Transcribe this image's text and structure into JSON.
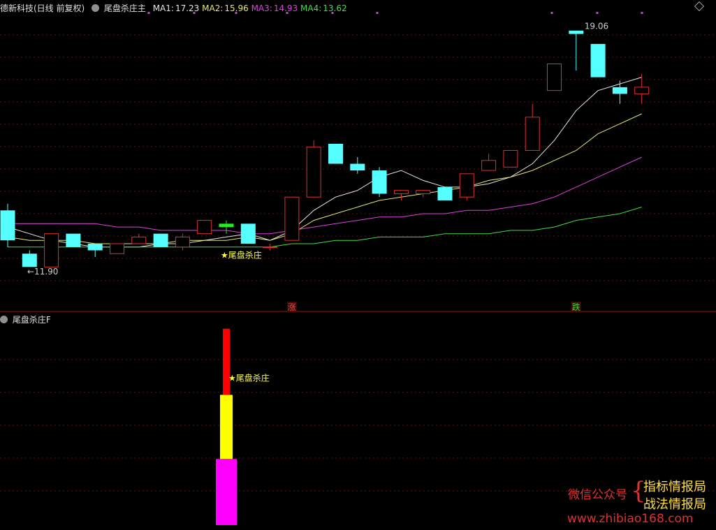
{
  "header": {
    "stock": "德新科技(日线 前复权)",
    "indicator_name": "尾盘杀庄主",
    "ma": [
      {
        "label": "MA1:",
        "value": "17.23",
        "color": "#e8e8e8"
      },
      {
        "label": "MA2:",
        "value": "15.96",
        "color": "#e8e870"
      },
      {
        "label": "MA3:",
        "value": "14.93",
        "color": "#e040e0"
      },
      {
        "label": "MA4:",
        "value": "13.62",
        "color": "#40e040"
      }
    ]
  },
  "sub_header": {
    "indicator_name": "尾盘杀庄F"
  },
  "watermark": {
    "wechat": "微信公众号",
    "name1": "指标情报局",
    "name2": "战法情报局",
    "url": "www.zhibiao168.com"
  },
  "icons": [
    "chevron-circle-icon",
    "diamond-icon"
  ],
  "chart_data": [
    {
      "type": "candlestick",
      "title": "德新科技(日线 前复权)",
      "ylim": [
        11.0,
        19.6
      ],
      "grid": true,
      "candles": [
        {
          "o": 13.7,
          "h": 13.9,
          "l": 12.6,
          "c": 12.8
        },
        {
          "o": 12.4,
          "h": 12.5,
          "l": 12.0,
          "c": 12.0
        },
        {
          "o": 12.0,
          "h": 13.0,
          "l": 12.0,
          "c": 13.0
        },
        {
          "o": 13.0,
          "h": 13.0,
          "l": 12.6,
          "c": 12.6
        },
        {
          "o": 12.7,
          "h": 12.7,
          "l": 12.3,
          "c": 12.5
        },
        {
          "o": 12.4,
          "h": 12.7,
          "l": 12.4,
          "c": 12.7
        },
        {
          "o": 12.7,
          "h": 13.0,
          "l": 12.7,
          "c": 12.9
        },
        {
          "o": 13.0,
          "h": 13.0,
          "l": 12.6,
          "c": 12.6
        },
        {
          "o": 12.6,
          "h": 13.0,
          "l": 12.5,
          "c": 12.9
        },
        {
          "o": 13.0,
          "h": 13.4,
          "l": 13.0,
          "c": 13.4
        },
        {
          "o": 13.2,
          "h": 13.4,
          "l": 13.0,
          "c": 13.3
        },
        {
          "o": 13.3,
          "h": 13.3,
          "l": 12.7,
          "c": 12.7
        },
        {
          "o": 12.6,
          "h": 12.7,
          "l": 12.5,
          "c": 12.6
        },
        {
          "o": 12.8,
          "h": 14.1,
          "l": 12.8,
          "c": 14.1
        },
        {
          "o": 14.1,
          "h": 15.8,
          "l": 14.1,
          "c": 15.6
        },
        {
          "o": 15.7,
          "h": 15.7,
          "l": 15.1,
          "c": 15.1
        },
        {
          "o": 15.1,
          "h": 15.3,
          "l": 14.8,
          "c": 14.9
        },
        {
          "o": 14.9,
          "h": 15.0,
          "l": 14.1,
          "c": 14.2
        },
        {
          "o": 14.2,
          "h": 14.3,
          "l": 14.0,
          "c": 14.3
        },
        {
          "o": 14.2,
          "h": 14.3,
          "l": 14.1,
          "c": 14.3
        },
        {
          "o": 14.4,
          "h": 14.4,
          "l": 14.0,
          "c": 14.0
        },
        {
          "o": 14.1,
          "h": 14.8,
          "l": 14.0,
          "c": 14.8
        },
        {
          "o": 14.9,
          "h": 15.4,
          "l": 14.9,
          "c": 15.2
        },
        {
          "o": 15.0,
          "h": 15.5,
          "l": 15.0,
          "c": 15.5
        },
        {
          "o": 15.5,
          "h": 16.9,
          "l": 15.5,
          "c": 16.5
        },
        {
          "o": 17.3,
          "h": 18.1,
          "l": 17.3,
          "c": 18.1
        },
        {
          "o": 19.1,
          "h": 19.1,
          "l": 17.9,
          "c": 19.0
        },
        {
          "o": 18.7,
          "h": 18.7,
          "l": 17.7,
          "c": 17.7
        },
        {
          "o": 17.4,
          "h": 17.6,
          "l": 16.9,
          "c": 17.2
        },
        {
          "o": 17.2,
          "h": 17.8,
          "l": 16.9,
          "c": 17.4
        }
      ],
      "series": [
        {
          "name": "MA1",
          "color": "#e8e8e8",
          "values": [
            13.2,
            13.0,
            12.8,
            12.7,
            12.6,
            12.6,
            12.6,
            12.7,
            12.7,
            12.8,
            12.9,
            13.0,
            12.8,
            13.1,
            13.7,
            14.1,
            14.3,
            14.7,
            14.9,
            14.6,
            14.4,
            14.4,
            14.5,
            14.7,
            15.1,
            15.8,
            16.7,
            17.3,
            17.5,
            17.7
          ]
        },
        {
          "name": "MA2",
          "color": "#e8e870",
          "values": [
            12.9,
            12.8,
            12.8,
            12.8,
            12.7,
            12.7,
            12.7,
            12.7,
            12.8,
            12.8,
            12.8,
            12.9,
            12.8,
            13.0,
            13.4,
            13.6,
            13.8,
            14.0,
            14.1,
            14.2,
            14.3,
            14.4,
            14.6,
            14.7,
            14.9,
            15.2,
            15.5,
            16.0,
            16.3,
            16.6
          ]
        },
        {
          "name": "MA3",
          "color": "#e040e0",
          "values": [
            13.3,
            13.3,
            13.3,
            13.3,
            13.3,
            13.2,
            13.2,
            13.1,
            13.1,
            13.1,
            13.1,
            13.0,
            13.0,
            13.1,
            13.2,
            13.3,
            13.4,
            13.5,
            13.5,
            13.6,
            13.6,
            13.7,
            13.7,
            13.8,
            13.9,
            14.1,
            14.4,
            14.7,
            15.0,
            15.3
          ]
        },
        {
          "name": "MA4",
          "color": "#40e040",
          "values": [
            12.6,
            12.6,
            12.6,
            12.6,
            12.6,
            12.6,
            12.6,
            12.6,
            12.6,
            12.6,
            12.6,
            12.6,
            12.6,
            12.7,
            12.7,
            12.8,
            12.8,
            12.9,
            12.9,
            12.9,
            13.0,
            13.0,
            13.0,
            13.1,
            13.1,
            13.2,
            13.4,
            13.5,
            13.6,
            13.8
          ]
        }
      ],
      "special_candle_index": 10,
      "annotations": [
        {
          "index": 10,
          "text": "★尾盘杀庄",
          "color": "#ffff33",
          "y": 12.4
        },
        {
          "index": 0,
          "text": "←11.90",
          "y": 11.9,
          "color": "#d0d0d0"
        },
        {
          "index": 26,
          "text": "19.06",
          "y": 19.06,
          "color": "#d0d0d0"
        }
      ],
      "markers": [
        {
          "index": 13,
          "text": "涨",
          "color": "#ff4040"
        },
        {
          "index": 26,
          "text": "跌",
          "color": "#30e030"
        }
      ]
    },
    {
      "type": "bar",
      "title": "尾盘杀庄F",
      "ylim": [
        0,
        100
      ],
      "index": 10,
      "segments": [
        {
          "from": 0,
          "to": 33,
          "color": "#ff00ff"
        },
        {
          "from": 33,
          "to": 65,
          "color": "#ffff00"
        },
        {
          "from": 65,
          "to": 98,
          "color": "#ff0000"
        }
      ],
      "annotations": [
        {
          "text": "★尾盘杀庄",
          "color": "#ffff33",
          "y": 74
        }
      ]
    }
  ]
}
